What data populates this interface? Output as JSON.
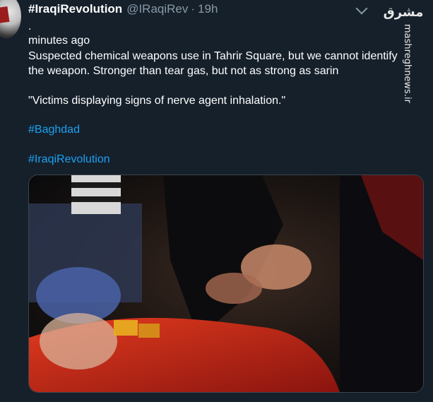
{
  "tweet": {
    "display_name": "#IraqiRevolution",
    "handle": "@IRaqiRev",
    "separator": "·",
    "time": "19h",
    "lines": {
      "l1": ".",
      "l2": "minutes ago",
      "l3": "Suspected chemical weapons use in Tahrir Square, but we cannot identify",
      "l4": "the weapon. Stronger than tear gas, but not as strong as sarin",
      "l5": "\"Victims displaying signs of nerve agent inhalation.\""
    },
    "hashtags": [
      "#Baghdad",
      "#IraqiRevolution"
    ]
  },
  "watermark": {
    "logo_text": "مشرق",
    "site": "mashreghnews.ir"
  },
  "icons": {
    "caret": "chevron-down-icon"
  }
}
